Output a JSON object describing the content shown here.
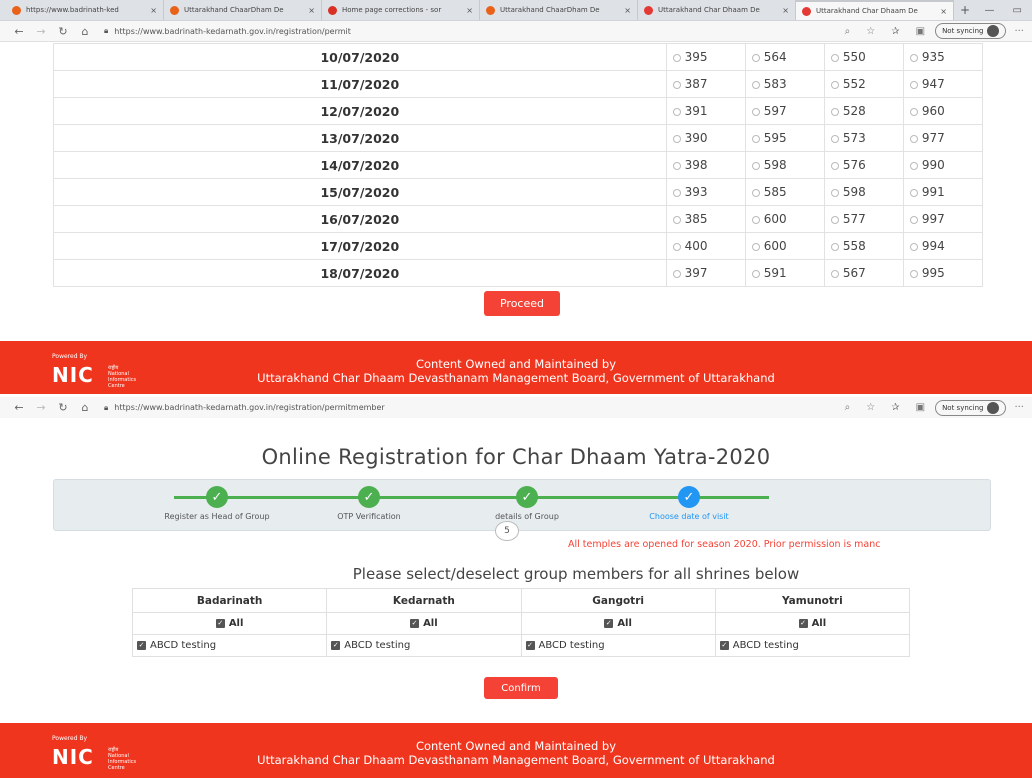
{
  "shot1": {
    "tabs": [
      {
        "title": "https://www.badrinath-ked",
        "color": "#e8621a",
        "active": false
      },
      {
        "title": "Uttarakhand ChaarDham De",
        "color": "#e8621a",
        "active": false
      },
      {
        "title": "Home page corrections - sor",
        "color": "#d93025",
        "active": false
      },
      {
        "title": "Uttarakhand ChaarDham De",
        "color": "#e8621a",
        "active": false
      },
      {
        "title": "Uttarakhand Char Dhaam De",
        "color": "#e53935",
        "active": false
      },
      {
        "title": "Uttarakhand Char Dhaam De",
        "color": "#e53935",
        "active": true
      }
    ],
    "tab_close": "×",
    "tab_new": "+",
    "url": "https://www.badrinath-kedarnath.gov.in/registration/permit",
    "sync_label": "Not syncing",
    "rows": [
      {
        "date": "10/07/2020",
        "values": [
          "395",
          "564",
          "550",
          "935"
        ]
      },
      {
        "date": "11/07/2020",
        "values": [
          "387",
          "583",
          "552",
          "947"
        ]
      },
      {
        "date": "12/07/2020",
        "values": [
          "391",
          "597",
          "528",
          "960"
        ]
      },
      {
        "date": "13/07/2020",
        "values": [
          "390",
          "595",
          "573",
          "977"
        ]
      },
      {
        "date": "14/07/2020",
        "values": [
          "398",
          "598",
          "576",
          "990"
        ]
      },
      {
        "date": "15/07/2020",
        "values": [
          "393",
          "585",
          "598",
          "991"
        ]
      },
      {
        "date": "16/07/2020",
        "values": [
          "385",
          "600",
          "577",
          "997"
        ]
      },
      {
        "date": "17/07/2020",
        "values": [
          "400",
          "600",
          "558",
          "994"
        ]
      },
      {
        "date": "18/07/2020",
        "values": [
          "397",
          "591",
          "567",
          "995"
        ]
      }
    ],
    "proceed_label": "Proceed"
  },
  "footer": {
    "powered_by": "Powered By",
    "logo_text": "NIC",
    "logo_sub": [
      "राष्ट्रीय",
      "National",
      "Informatics",
      "Centre"
    ],
    "line1": "Content Owned and Maintained by",
    "line2": "Uttarakhand Char Dhaam Devasthanam Management Board, Government of Uttarakhand",
    "color": "#f0351f"
  },
  "shot2": {
    "url": "https://www.badrinath-kedarnath.gov.in/registration/permitmember",
    "sync_label": "Not syncing",
    "page_title": "Online Registration for Char Dhaam Yatra-2020",
    "steps": [
      {
        "label": "Register as Head of Group",
        "state": "done"
      },
      {
        "label": "OTP Verification",
        "state": "done"
      },
      {
        "label": "details of Group",
        "state": "done"
      },
      {
        "label": "Choose date of visit",
        "state": "current"
      }
    ],
    "step_bubble": "5",
    "notice": "All temples are opened for season 2020. Prior permission is manc",
    "select_title": "Please select/deselect group members for all shrines below",
    "shrines": [
      "Badarinath",
      "Kedarnath",
      "Gangotri",
      "Yamunotri"
    ],
    "all_label": "All",
    "member": "ABCD testing",
    "confirm_label": "Confirm"
  }
}
